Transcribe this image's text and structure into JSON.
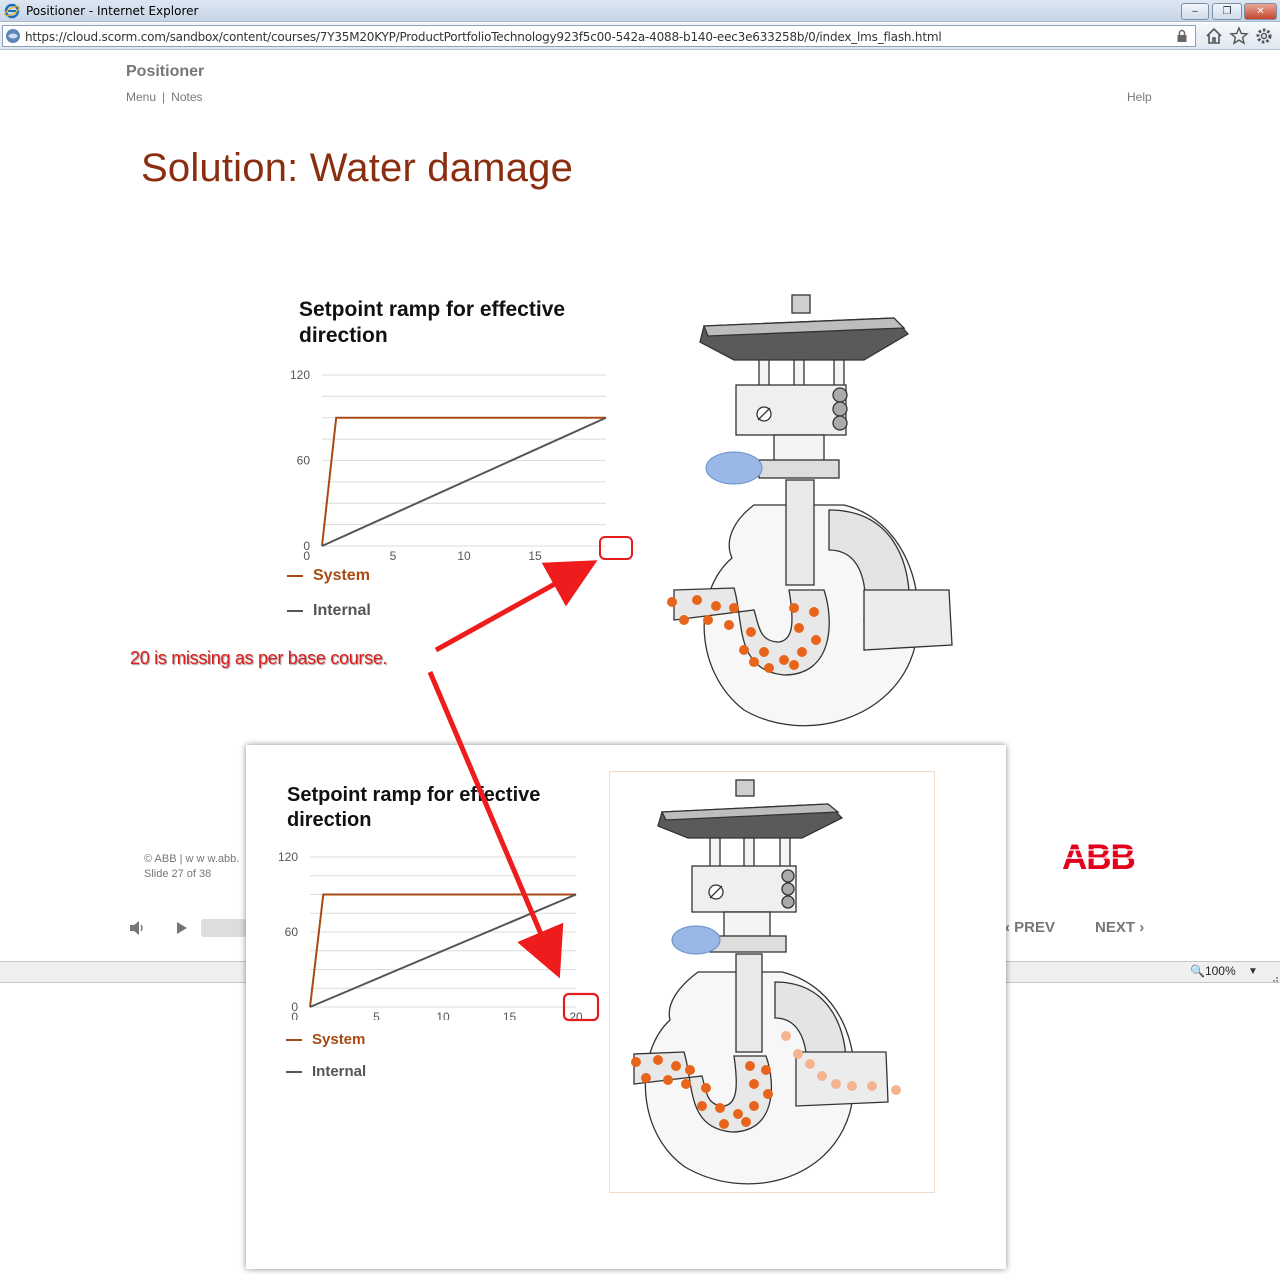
{
  "browser": {
    "window_title": "Positioner - Internet Explorer",
    "url": "https://cloud.scorm.com/sandbox/content/courses/7Y35M20KYP/ProductPortfolioTechnology923f5c00-542a-4088-b140-eec3e633258b/0/index_lms_flash.html",
    "zoom": "100%"
  },
  "player": {
    "course_title": "Positioner",
    "nav": {
      "menu": "Menu",
      "separator": "|",
      "notes": "Notes",
      "help": "Help"
    },
    "slide_title": "Solution: Water damage",
    "footer": {
      "copyright": "© ABB | w w w.abb.",
      "slide_counter": "Slide 27 of 38"
    },
    "logo_text": "ABB",
    "prev_label": "PREV",
    "next_label": "NEXT",
    "colors": {
      "title": "#8a2e10",
      "system": "#a84a14",
      "internal": "#555555",
      "abb_red": "#e2001a",
      "annotation": "#e01b1b"
    }
  },
  "annotation": {
    "text": "20 is missing as per base course."
  },
  "chart_data": [
    {
      "type": "line",
      "title": "Setpoint ramp for effective direction",
      "x_ticks": [
        "0",
        "5",
        "10",
        "15"
      ],
      "y_ticks": [
        "0",
        "60",
        "120"
      ],
      "ylim": [
        0,
        120
      ],
      "xlim": [
        0,
        20
      ],
      "series": [
        {
          "name": "System",
          "color": "#a84a14",
          "points": [
            [
              0,
              0
            ],
            [
              1,
              90
            ],
            [
              20,
              90
            ]
          ]
        },
        {
          "name": "Internal",
          "color": "#555555",
          "points": [
            [
              0,
              0
            ],
            [
              20,
              90
            ]
          ]
        }
      ],
      "grid": true,
      "legend": "bottom-left"
    },
    {
      "type": "line",
      "title": "Setpoint ramp for effective direction",
      "x_ticks": [
        "0",
        "5",
        "10",
        "15",
        "20"
      ],
      "y_ticks": [
        "0",
        "60",
        "120"
      ],
      "ylim": [
        0,
        120
      ],
      "xlim": [
        0,
        20
      ],
      "series": [
        {
          "name": "System",
          "color": "#a84a14",
          "points": [
            [
              0,
              0
            ],
            [
              1,
              90
            ],
            [
              20,
              90
            ]
          ]
        },
        {
          "name": "Internal",
          "color": "#555555",
          "points": [
            [
              0,
              0
            ],
            [
              20,
              90
            ]
          ]
        }
      ],
      "grid": true,
      "legend": "bottom-left"
    }
  ]
}
